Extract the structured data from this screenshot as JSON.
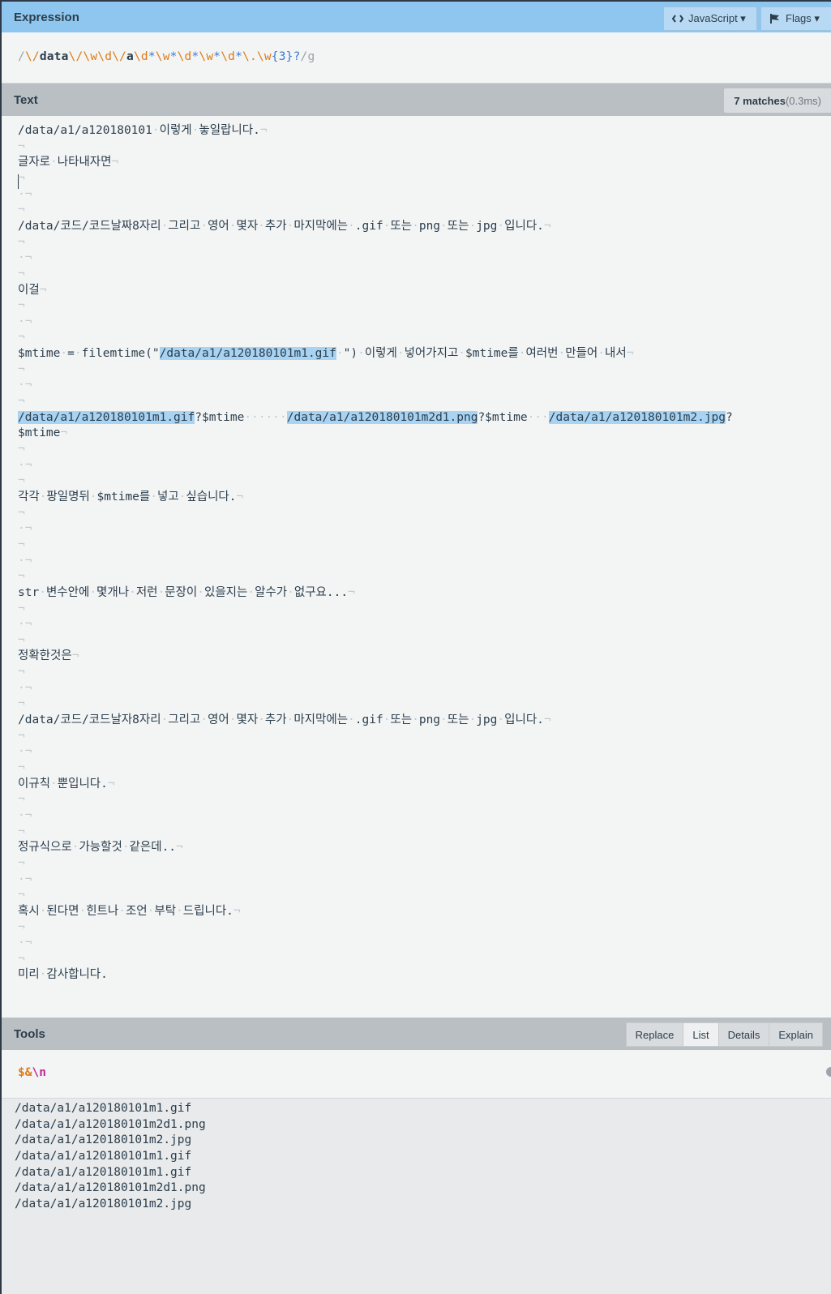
{
  "expression_panel": {
    "title": "Expression",
    "language_button": "JavaScript ▾",
    "flags_button": "Flags ▾",
    "expression_parts": [
      {
        "t": "/",
        "c": "#9aa3aa"
      },
      {
        "t": "\\/",
        "c": "#dd7b16"
      },
      {
        "t": "data",
        "c": "#2c3e4c"
      },
      {
        "t": "\\/",
        "c": "#dd7b16"
      },
      {
        "t": "\\w",
        "c": "#dd7b16"
      },
      {
        "t": "\\d",
        "c": "#dd7b16"
      },
      {
        "t": "\\/",
        "c": "#dd7b16"
      },
      {
        "t": "a",
        "c": "#2c3e4c"
      },
      {
        "t": "\\d",
        "c": "#dd7b16"
      },
      {
        "t": "*",
        "c": "#3a78d6"
      },
      {
        "t": "\\w",
        "c": "#dd7b16"
      },
      {
        "t": "*",
        "c": "#3a78d6"
      },
      {
        "t": "\\d",
        "c": "#dd7b16"
      },
      {
        "t": "*",
        "c": "#3a78d6"
      },
      {
        "t": "\\w",
        "c": "#dd7b16"
      },
      {
        "t": "*",
        "c": "#3a78d6"
      },
      {
        "t": "\\d",
        "c": "#dd7b16"
      },
      {
        "t": "*",
        "c": "#3a78d6"
      },
      {
        "t": "\\.",
        "c": "#dd7b16"
      },
      {
        "t": "\\w",
        "c": "#dd7b16"
      },
      {
        "t": "{3}",
        "c": "#3a78d6"
      },
      {
        "t": "?",
        "c": "#3a78d6"
      },
      {
        "t": "/g",
        "c": "#9aa3aa"
      }
    ]
  },
  "text_panel": {
    "title": "Text",
    "matches_label": "7 matches",
    "matches_time": " (0.3ms)",
    "lines": [
      [
        [
          "/data/a1/a120180101"
        ],
        [
          "·",
          "w"
        ],
        [
          "이렇게"
        ],
        [
          "·",
          "w"
        ],
        [
          "놓일랍니다."
        ],
        [
          "¬",
          "w"
        ]
      ],
      [
        [
          "¬",
          "w"
        ]
      ],
      [
        [
          "글자로"
        ],
        [
          "·",
          "w"
        ],
        [
          "나타내자면"
        ],
        [
          "¬",
          "w"
        ]
      ],
      [
        [
          "¬",
          "w"
        ]
      ],
      [
        [
          "·¬",
          "w"
        ]
      ],
      [
        [
          "¬",
          "w"
        ]
      ],
      [
        [
          "/data/코드/코드날짜8자리"
        ],
        [
          "·",
          "w"
        ],
        [
          "그리고"
        ],
        [
          "·",
          "w"
        ],
        [
          "영어"
        ],
        [
          "·",
          "w"
        ],
        [
          "몇자"
        ],
        [
          "·",
          "w"
        ],
        [
          "추가"
        ],
        [
          "·",
          "w"
        ],
        [
          "마지막에는"
        ],
        [
          "·",
          "w"
        ],
        [
          ".gif"
        ],
        [
          "·",
          "w"
        ],
        [
          "또는"
        ],
        [
          "·",
          "w"
        ],
        [
          "png"
        ],
        [
          "·",
          "w"
        ],
        [
          "또는"
        ],
        [
          "·",
          "w"
        ],
        [
          "jpg"
        ],
        [
          "·",
          "w"
        ],
        [
          "입니다."
        ],
        [
          "¬",
          "w"
        ]
      ],
      [
        [
          "¬",
          "w"
        ]
      ],
      [
        [
          "·¬",
          "w"
        ]
      ],
      [
        [
          "¬",
          "w"
        ]
      ],
      [
        [
          "이걸"
        ],
        [
          "¬",
          "w"
        ]
      ],
      [
        [
          "¬",
          "w"
        ]
      ],
      [
        [
          "·¬",
          "w"
        ]
      ],
      [
        [
          "¬",
          "w"
        ]
      ],
      [
        [
          "$mtime"
        ],
        [
          "·",
          "w"
        ],
        [
          "="
        ],
        [
          "·",
          "w"
        ],
        [
          "filemtime(\""
        ],
        [
          "/data/a1/a120180101m1.gif",
          "h"
        ],
        [
          "·",
          "w"
        ],
        [
          "\")"
        ],
        [
          "·",
          "w"
        ],
        [
          "이렇게"
        ],
        [
          "·",
          "w"
        ],
        [
          "넣어가지고"
        ],
        [
          "·",
          "w"
        ],
        [
          "$mtime를"
        ],
        [
          "·",
          "w"
        ],
        [
          "여러번"
        ],
        [
          "·",
          "w"
        ],
        [
          "만들어"
        ],
        [
          "·",
          "w"
        ],
        [
          "내서"
        ],
        [
          "¬",
          "w"
        ]
      ],
      [
        [
          "¬",
          "w"
        ]
      ],
      [
        [
          "·¬",
          "w"
        ]
      ],
      [
        [
          "¬",
          "w"
        ]
      ],
      [
        [
          "/data/a1/a120180101m1.gif",
          "h"
        ],
        [
          "?$mtime"
        ],
        [
          "······",
          "w"
        ],
        [
          "/data/a1/a120180101m2d1.png",
          "h"
        ],
        [
          "?$mtime"
        ],
        [
          "···",
          "w"
        ],
        [
          "/data/a1/a120180101m2.jpg",
          "h"
        ],
        [
          "?"
        ]
      ],
      [
        [
          "$mtime"
        ],
        [
          "¬",
          "w"
        ]
      ],
      [
        [
          "¬",
          "w"
        ]
      ],
      [
        [
          "·¬",
          "w"
        ]
      ],
      [
        [
          "¬",
          "w"
        ]
      ],
      [
        [
          "각각"
        ],
        [
          "·",
          "w"
        ],
        [
          "팡일명뒤"
        ],
        [
          "·",
          "w"
        ],
        [
          "$mtime를"
        ],
        [
          "·",
          "w"
        ],
        [
          "넣고"
        ],
        [
          "·",
          "w"
        ],
        [
          "싶습니다."
        ],
        [
          "¬",
          "w"
        ]
      ],
      [
        [
          "¬",
          "w"
        ]
      ],
      [
        [
          "·¬",
          "w"
        ]
      ],
      [
        [
          "¬",
          "w"
        ]
      ],
      [
        [
          "·¬",
          "w"
        ]
      ],
      [
        [
          "¬",
          "w"
        ]
      ],
      [
        [
          "str"
        ],
        [
          "·",
          "w"
        ],
        [
          "변수안에"
        ],
        [
          "·",
          "w"
        ],
        [
          "몇개나"
        ],
        [
          "·",
          "w"
        ],
        [
          "저런"
        ],
        [
          "·",
          "w"
        ],
        [
          "문장이"
        ],
        [
          "·",
          "w"
        ],
        [
          "있을지는"
        ],
        [
          "·",
          "w"
        ],
        [
          "알수가"
        ],
        [
          "·",
          "w"
        ],
        [
          "없구요..."
        ],
        [
          "¬",
          "w"
        ]
      ],
      [
        [
          "¬",
          "w"
        ]
      ],
      [
        [
          "·¬",
          "w"
        ]
      ],
      [
        [
          "¬",
          "w"
        ]
      ],
      [
        [
          "정확한것은"
        ],
        [
          "¬",
          "w"
        ]
      ],
      [
        [
          "¬",
          "w"
        ]
      ],
      [
        [
          "·¬",
          "w"
        ]
      ],
      [
        [
          "¬",
          "w"
        ]
      ],
      [
        [
          "/data/코드/코드날자8자리"
        ],
        [
          "·",
          "w"
        ],
        [
          "그리고"
        ],
        [
          "·",
          "w"
        ],
        [
          "영어"
        ],
        [
          "·",
          "w"
        ],
        [
          "몇자"
        ],
        [
          "·",
          "w"
        ],
        [
          "추가"
        ],
        [
          "·",
          "w"
        ],
        [
          "마지막에는"
        ],
        [
          "·",
          "w"
        ],
        [
          ".gif"
        ],
        [
          "·",
          "w"
        ],
        [
          "또는"
        ],
        [
          "·",
          "w"
        ],
        [
          "png"
        ],
        [
          "·",
          "w"
        ],
        [
          "또는"
        ],
        [
          "·",
          "w"
        ],
        [
          "jpg"
        ],
        [
          "·",
          "w"
        ],
        [
          "입니다."
        ],
        [
          "¬",
          "w"
        ]
      ],
      [
        [
          "¬",
          "w"
        ]
      ],
      [
        [
          "·¬",
          "w"
        ]
      ],
      [
        [
          "¬",
          "w"
        ]
      ],
      [
        [
          "이규칙"
        ],
        [
          "·",
          "w"
        ],
        [
          "뿐입니다."
        ],
        [
          "¬",
          "w"
        ]
      ],
      [
        [
          "¬",
          "w"
        ]
      ],
      [
        [
          "·¬",
          "w"
        ]
      ],
      [
        [
          "¬",
          "w"
        ]
      ],
      [
        [
          "정규식으로"
        ],
        [
          "·",
          "w"
        ],
        [
          "가능할것"
        ],
        [
          "·",
          "w"
        ],
        [
          "같은데.."
        ],
        [
          "¬",
          "w"
        ]
      ],
      [
        [
          "¬",
          "w"
        ]
      ],
      [
        [
          "·¬",
          "w"
        ]
      ],
      [
        [
          "¬",
          "w"
        ]
      ],
      [
        [
          "혹시"
        ],
        [
          "·",
          "w"
        ],
        [
          "된다면"
        ],
        [
          "·",
          "w"
        ],
        [
          "힌트나"
        ],
        [
          "·",
          "w"
        ],
        [
          "조언"
        ],
        [
          "·",
          "w"
        ],
        [
          "부탁"
        ],
        [
          "·",
          "w"
        ],
        [
          "드립니다."
        ],
        [
          "¬",
          "w"
        ]
      ],
      [
        [
          "¬",
          "w"
        ]
      ],
      [
        [
          "·¬",
          "w"
        ]
      ],
      [
        [
          "¬",
          "w"
        ]
      ],
      [
        [
          "미리"
        ],
        [
          "·",
          "w"
        ],
        [
          "감사합니다."
        ]
      ]
    ]
  },
  "tools_panel": {
    "title": "Tools",
    "tabs": [
      "Replace",
      "List",
      "Details",
      "Explain"
    ],
    "active_tab": "List",
    "list_expr_parts": [
      {
        "t": "$&",
        "c": "#dd7b16"
      },
      {
        "t": "\\n",
        "c": "#c0269a"
      }
    ],
    "results": [
      "/data/a1/a120180101m1.gif",
      "/data/a1/a120180101m2d1.png",
      "/data/a1/a120180101m2.jpg",
      "/data/a1/a120180101m1.gif",
      "/data/a1/a120180101m1.gif",
      "/data/a1/a120180101m2d1.png",
      "/data/a1/a120180101m2.jpg"
    ]
  }
}
